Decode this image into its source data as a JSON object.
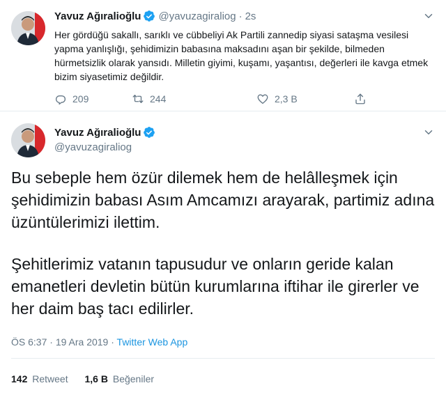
{
  "tweet1": {
    "name": "Yavuz Ağıralioğlu",
    "handle": "@yavuzagiraliog",
    "separator": "·",
    "time": "2s",
    "text": "Her gördüğü sakallı, sarıklı ve cübbeliyi Ak Partili zannedip siyasi sataşma vesilesi yapma yanlışlığı, şehidimizin babasına maksadını aşan bir şekilde, bilmeden hürmetsizlik olarak yansıdı. Milletin giyimi, kuşamı, yaşantısı, değerleri ile kavga etmek bizim siyasetimiz değildir.",
    "replies": "209",
    "retweets": "244",
    "likes": "2,3 B"
  },
  "tweet2": {
    "name": "Yavuz Ağıralioğlu",
    "handle": "@yavuzagiraliog",
    "paragraph1": "Bu sebeple hem özür dilemek hem de helâlleşmek için şehidimizin babası Asım Amcamızı arayarak, partimiz adına üzüntülerimizi ilettim.",
    "paragraph2": "Şehitlerimiz vatanın tapusudur ve onların geride kalan emanetleri devletin bütün kurumlarına iftihar ile girerler ve her daim baş tacı edilirler.",
    "time": "ÖS 6:37",
    "date_sep": "·",
    "date": "19 Ara 2019",
    "source_sep": "·",
    "source": "Twitter Web App",
    "retweet_count": "142",
    "retweet_label": "Retweet",
    "like_count": "1,6 B",
    "like_label": "Beğeniler"
  },
  "icons": {
    "verified": "verified-badge-icon",
    "chevron": "chevron-down-icon",
    "reply": "reply-icon",
    "retweet": "retweet-icon",
    "like": "heart-icon",
    "share": "share-icon"
  },
  "colors": {
    "accent": "#1da1f2",
    "link": "#1b95e0",
    "secondary_text": "#657786",
    "primary_text": "#14171a"
  }
}
